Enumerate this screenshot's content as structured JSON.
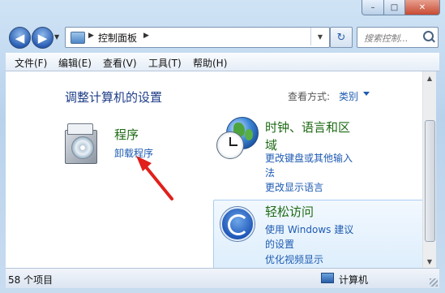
{
  "window": {
    "minimize": "–",
    "maximize": "□",
    "close": "✕",
    "accent": "#c74a32"
  },
  "nav": {
    "back_icon": "arrow-left-icon",
    "forward_icon": "arrow-right-icon",
    "back": "◀",
    "forward": "▶",
    "dropdown": "▼",
    "refresh": "↻"
  },
  "address": {
    "crumb": "控制面板",
    "sep": "▶"
  },
  "search": {
    "placeholder": "搜索控制..."
  },
  "menu": {
    "items": [
      "文件(F)",
      "编辑(E)",
      "查看(V)",
      "工具(T)",
      "帮助(H)"
    ]
  },
  "main": {
    "heading": "调整计算机的设置",
    "view_label": "查看方式:",
    "view_value": "类别",
    "categories": [
      {
        "title": "程序",
        "links": [
          "卸载程序"
        ],
        "icon": "programs-icon"
      },
      {
        "title_line1": "时钟、语言和区",
        "title_line2": "域",
        "links": [
          "更改键盘或其他输入",
          "法",
          "更改显示语言"
        ],
        "icon": "clock-globe-icon"
      },
      {
        "title": "轻松访问",
        "links": [
          "使用 Windows 建议",
          "的设置",
          "优化视频显示"
        ],
        "icon": "ease-of-access-icon"
      }
    ],
    "link_color": "#1e5bb2",
    "title_color": "#1e6a14"
  },
  "status": {
    "items_count": "58 个项目",
    "location": "计算机"
  },
  "annotation_color": "#e0201c"
}
